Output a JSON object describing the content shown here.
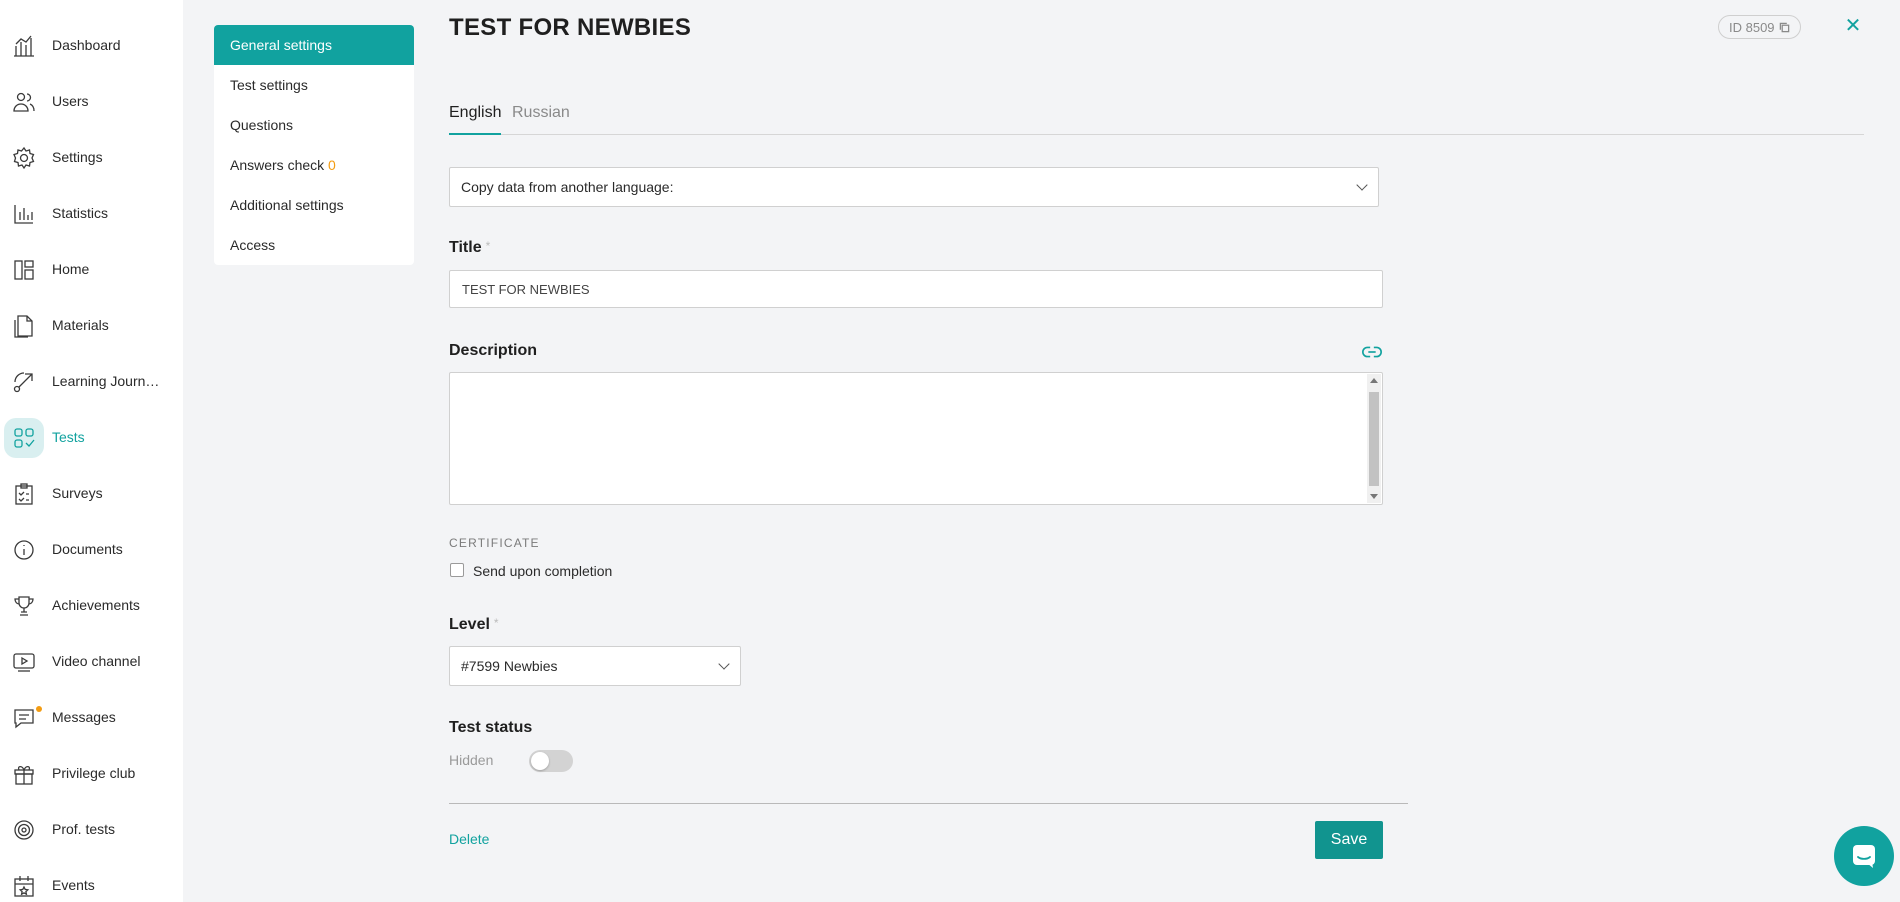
{
  "nav": {
    "items": [
      {
        "label": "Dashboard",
        "icon": "dashboard-icon"
      },
      {
        "label": "Users",
        "icon": "users-icon"
      },
      {
        "label": "Settings",
        "icon": "gear-icon"
      },
      {
        "label": "Statistics",
        "icon": "bar-chart-icon"
      },
      {
        "label": "Home",
        "icon": "home-layout-icon"
      },
      {
        "label": "Materials",
        "icon": "document-icon"
      },
      {
        "label": "Learning Journ…",
        "icon": "journey-arrow-icon"
      },
      {
        "label": "Tests",
        "icon": "tests-grid-icon",
        "active": true
      },
      {
        "label": "Surveys",
        "icon": "clipboard-icon"
      },
      {
        "label": "Documents",
        "icon": "info-circle-icon"
      },
      {
        "label": "Achievements",
        "icon": "trophy-icon"
      },
      {
        "label": "Video channel",
        "icon": "video-icon"
      },
      {
        "label": "Messages",
        "icon": "chat-icon",
        "unread_dot": true
      },
      {
        "label": "Privilege club",
        "icon": "gift-icon"
      },
      {
        "label": "Prof. tests",
        "icon": "target-icon"
      },
      {
        "label": "Events",
        "icon": "calendar-icon"
      }
    ]
  },
  "submenu": {
    "items": [
      {
        "label": "General settings",
        "active": true
      },
      {
        "label": "Test settings"
      },
      {
        "label": "Questions"
      },
      {
        "label": "Answers check",
        "badge": "0"
      },
      {
        "label": "Additional settings"
      },
      {
        "label": "Access"
      }
    ]
  },
  "header": {
    "title": "TEST FOR NEWBIES",
    "id_label": "ID 8509"
  },
  "tabs": [
    {
      "label": "English",
      "active": true
    },
    {
      "label": "Russian"
    }
  ],
  "form": {
    "copy_select": "Copy data from another language:",
    "title_label": "Title",
    "required_mark": "*",
    "title_value": "TEST FOR NEWBIES",
    "description_label": "Description",
    "certificate_caption": "CERTIFICATE",
    "send_upon_completion": "Send upon completion",
    "level_label": "Level",
    "level_value": "#7599 Newbies",
    "status_label": "Test status",
    "status_value": "Hidden",
    "delete_label": "Delete",
    "save_label": "Save"
  },
  "colors": {
    "accent": "#11a29f",
    "badge": "#f39c12",
    "background": "#f3f4f6"
  }
}
